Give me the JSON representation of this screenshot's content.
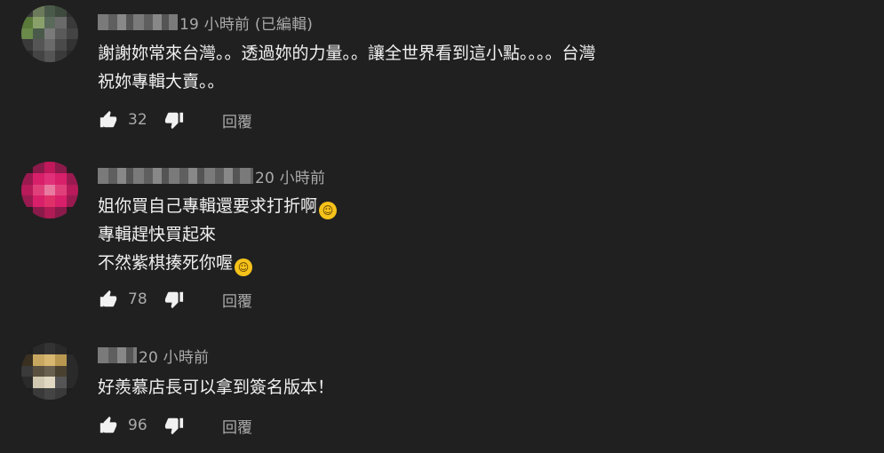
{
  "comments": [
    {
      "time": "19 小時前 (已編輯)",
      "lines": [
        "謝謝妳常來台灣。。透過妳的力量。。讓全世界看到這小點。。。。台灣",
        "祝妳專輯大賣。。"
      ],
      "likes": "32",
      "reply_label": "回覆",
      "avatar_icon": "pixelated-avatar-green"
    },
    {
      "time": "20 小時前",
      "lines": [
        "姐你買自己專輯還要求打折啊",
        "專輯趕快買起來",
        "不然紫棋揍死你喔"
      ],
      "likes": "78",
      "reply_label": "回覆",
      "avatar_icon": "pixelated-avatar-pink"
    },
    {
      "time": "20 小時前",
      "lines": [
        "好羨慕店長可以拿到簽名版本！"
      ],
      "likes": "96",
      "reply_label": "回覆",
      "avatar_icon": "pixelated-avatar-dark"
    }
  ],
  "emoji": {
    "laughing": "rolling-on-floor-laughing-emoji",
    "smirk": "smirking-face-emoji"
  },
  "colors": {
    "background": "#202020",
    "text": "#f1f1f1",
    "secondary": "#aaaaaa"
  }
}
